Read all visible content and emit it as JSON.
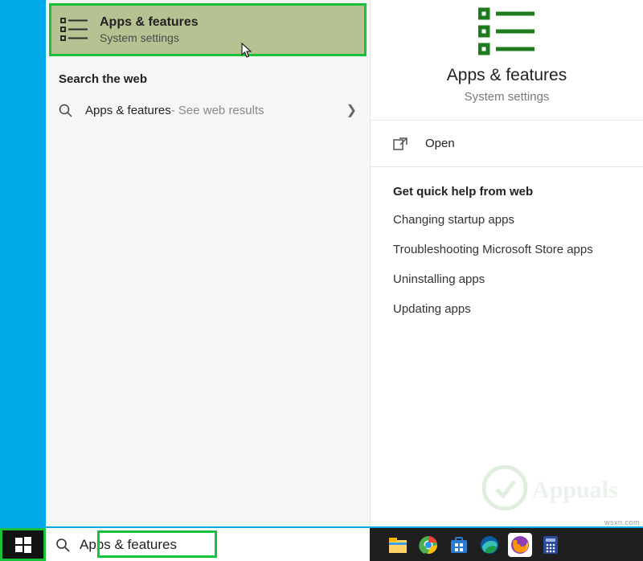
{
  "bestMatch": {
    "title": "Apps & features",
    "subtitle": "System settings"
  },
  "sectionWebHeader": "Search the web",
  "webResult": {
    "label": "Apps & features",
    "suffix": " - See web results"
  },
  "detail": {
    "title": "Apps & features",
    "subtitle": "System settings"
  },
  "openLabel": "Open",
  "help": {
    "title": "Get quick help from web",
    "links": [
      "Changing startup apps",
      "Troubleshooting Microsoft Store apps",
      "Uninstalling apps",
      "Updating apps"
    ]
  },
  "searchInput": "Apps & features",
  "watermark": "Appuals",
  "attribution": "wsxn.com"
}
